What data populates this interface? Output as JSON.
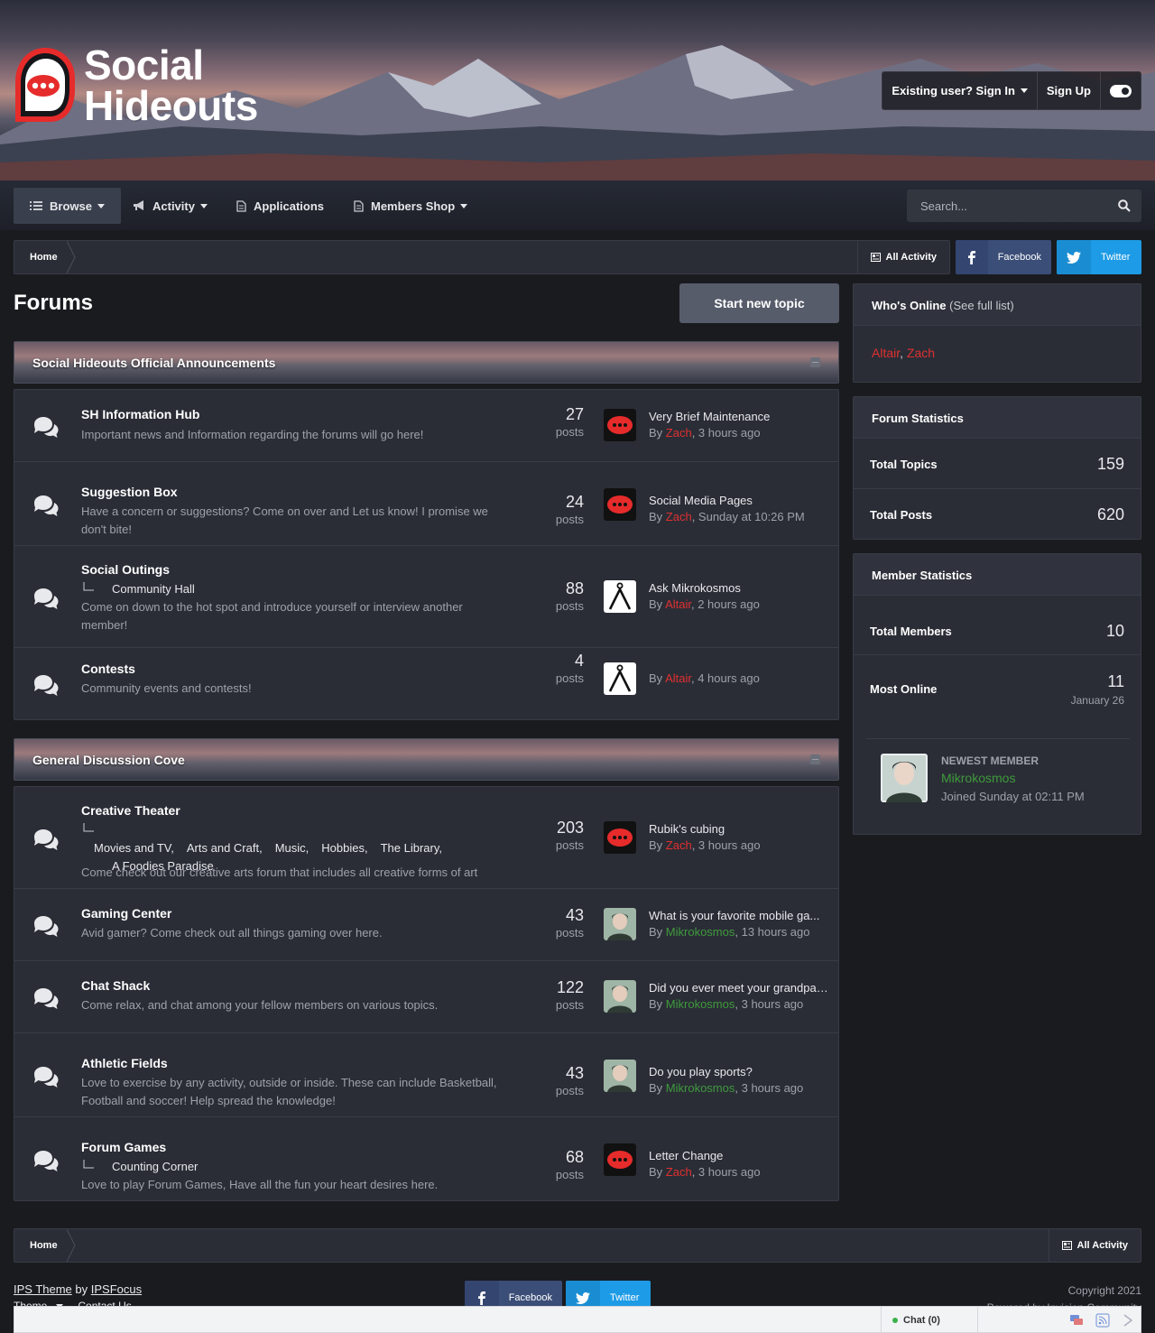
{
  "site": {
    "name_line1": "Social",
    "name_line2": "Hideouts"
  },
  "user_bar": {
    "sign_in": "Existing user? Sign In",
    "sign_up": "Sign Up"
  },
  "nav": {
    "items": [
      {
        "label": "Browse",
        "icon": "list-icon",
        "dropdown": true
      },
      {
        "label": "Activity",
        "icon": "megaphone-icon",
        "dropdown": true
      },
      {
        "label": "Applications",
        "icon": "document-icon",
        "dropdown": false
      },
      {
        "label": "Members Shop",
        "icon": "document-icon",
        "dropdown": true
      }
    ],
    "search_placeholder": "Search..."
  },
  "breadcrumb": {
    "home": "Home",
    "all_activity": "All Activity"
  },
  "social": {
    "facebook": "Facebook",
    "twitter": "Twitter"
  },
  "page": {
    "title": "Forums",
    "new_topic": "Start new topic"
  },
  "categories": [
    {
      "title": "Social Hideouts Official Announcements",
      "forums": [
        {
          "title": "SH Information Hub",
          "subforums": [],
          "desc": "Important news and Information regarding the forums will go here!",
          "count": "27",
          "count_label": "posts",
          "last_title": "Very Brief Maintenance",
          "by": "By ",
          "author": "Zach",
          "when": ", 3 hours ago"
        },
        {
          "title": "Suggestion Box",
          "subforums": [],
          "desc": "Have a concern or suggestions?  Come on over and Let us know!  I promise we don't bite!",
          "count": "24",
          "count_label": "posts",
          "last_title": "Social Media Pages",
          "by": "By ",
          "author": "Zach",
          "when": ", Sunday at 10:26 PM"
        },
        {
          "title": "Social Outings",
          "subforums": [
            "Community Hall"
          ],
          "desc": "Come on down to the hot spot and introduce yourself or interview another member!",
          "count": "88",
          "count_label": "posts",
          "last_title": "Ask Mikrokosmos",
          "by": "By ",
          "author": "Altair",
          "when": ", 2 hours ago"
        },
        {
          "title": "Contests",
          "subforums": [],
          "desc": "Community events and contests!",
          "count": "4",
          "count_label": "posts",
          "last_title": "",
          "by": "By ",
          "author": "Altair",
          "when": ", 4 hours ago"
        }
      ]
    },
    {
      "title": "General Discussion Cove",
      "forums": [
        {
          "title": "Creative Theater",
          "subforums": [
            "Movies and TV,",
            "Arts and Craft,",
            "Music,",
            "Hobbies,",
            "The Library,",
            "A Foodies Paradise"
          ],
          "desc": "Come check out our creative arts forum that includes all creative forms of art",
          "count": "203",
          "count_label": "posts",
          "last_title": "Rubik's cubing",
          "by": "By ",
          "author": "Zach",
          "when": ", 3 hours ago"
        },
        {
          "title": "Gaming Center",
          "subforums": [],
          "desc": "Avid gamer?   Come check out all things gaming over here.",
          "count": "43",
          "count_label": "posts",
          "last_title": "What is your favorite mobile ga...",
          "by": "By ",
          "author": "Mikrokosmos",
          "when": ", 13 hours ago"
        },
        {
          "title": "Chat Shack",
          "subforums": [],
          "desc": "Come relax, and chat among your fellow members on various topics.",
          "count": "122",
          "count_label": "posts",
          "last_title": "Did you ever meet your grandpar...",
          "by": "By ",
          "author": "Mikrokosmos",
          "when": ", 3 hours ago"
        },
        {
          "title": "Athletic Fields",
          "subforums": [],
          "desc": "Love to exercise by any activity, outside or inside. These can include Basketball, Football and soccer!  Help spread the knowledge!",
          "count": "43",
          "count_label": "posts",
          "last_title": "Do you play sports?",
          "by": "By ",
          "author": "Mikrokosmos",
          "when": ", 3 hours ago"
        },
        {
          "title": "Forum Games",
          "subforums": [
            "Counting Corner"
          ],
          "desc": "Love to play Forum Games, Have all the fun your heart desires here.",
          "count": "68",
          "count_label": "posts",
          "last_title": "Letter Change",
          "by": "By ",
          "author": "Zach",
          "when": ", 3 hours ago"
        }
      ]
    }
  ],
  "sidebar": {
    "online": {
      "title": "Who's Online",
      "see": "(See full list)",
      "users": [
        "Altair",
        "Zach"
      ],
      "sep": ", "
    },
    "forum_stats": {
      "title": "Forum Statistics",
      "topics_label": "Total Topics",
      "topics": "159",
      "posts_label": "Total Posts",
      "posts": "620"
    },
    "member_stats": {
      "title": "Member Statistics",
      "members_label": "Total Members",
      "members": "10",
      "most_label": "Most Online",
      "most": "11",
      "most_date": "January 26",
      "newest_label": "NEWEST MEMBER",
      "newest_name": "Mikrokosmos",
      "newest_joined": "Joined Sunday at 02:11 PM"
    }
  },
  "footer": {
    "theme": "IPS Theme",
    "by": " by ",
    "focus": "IPSFocus",
    "theme_menu": "Theme",
    "contact": "Contact Us",
    "copyright": "Copyright 2021",
    "powered": "Powered by Invision Community"
  },
  "chat": {
    "label": "Chat",
    "count": "(0)"
  },
  "colors": {
    "accent_red": "#e03030",
    "member_green": "#3f9a3c",
    "twitter": "#1d9be6",
    "facebook": "#3b4e78"
  }
}
